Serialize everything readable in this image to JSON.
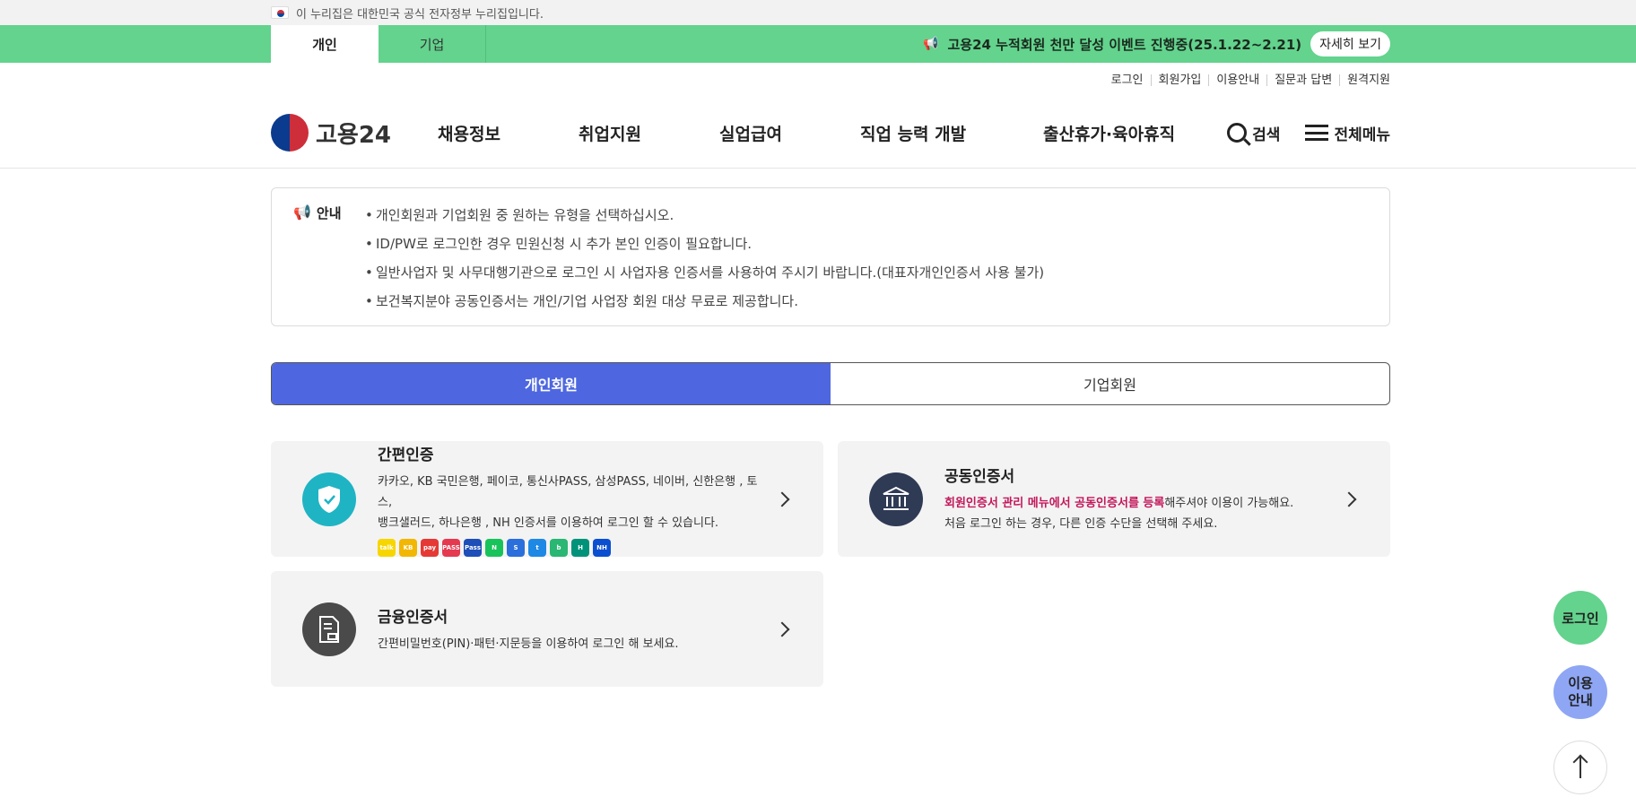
{
  "gov_banner": {
    "text": "이 누리집은 대한민국 공식 전자정부 누리집입니다."
  },
  "top_tabs": [
    {
      "label": "개인"
    },
    {
      "label": "기업"
    }
  ],
  "event": {
    "text": "고용24 누적회원 천만 달성 이벤트 진행중(25.1.22~2.21)",
    "button": "자세히 보기"
  },
  "util_links": [
    "로그인",
    "회원가입",
    "이용안내",
    "질문과 답변",
    "원격지원"
  ],
  "header": {
    "logo": "고용24",
    "menu": [
      "채용정보",
      "취업지원",
      "실업급여",
      "직업 능력 개발",
      "출산휴가·육아휴직"
    ],
    "search": "검색",
    "all_menu": "전체메뉴"
  },
  "notice": {
    "label": "안내",
    "items": [
      "개인회원과 기업회원 중 원하는 유형을 선택하십시오.",
      "ID/PW로 로그인한 경우 민원신청 시 추가 본인 인증이 필요합니다.",
      "일반사업자 및 사무대행기관으로 로그인 시 사업자용 인증서를 사용하여 주시기 바랍니다.(대표자개인인증서 사용 불가)",
      "보건복지분야 공동인증서는 개인/기업 사업장 회원 대상 무료로 제공합니다."
    ]
  },
  "member_tabs": [
    {
      "label": "개인회원",
      "active": true
    },
    {
      "label": "기업회원",
      "active": false
    }
  ],
  "cards": {
    "simple": {
      "title": "간편인증",
      "desc1": "카카오, KB 국민은행, 페이코, 통신사PASS, 삼성PASS, 네이버, 신한은행 , 토스,",
      "desc2": "뱅크샐러드, 하나은행 , NH 인증서를 이용하여 로그인 할 수 있습니다.",
      "banks": [
        {
          "label": "talk",
          "color": "#f7d600"
        },
        {
          "label": "KB",
          "color": "#f2b705"
        },
        {
          "label": "pay",
          "color": "#e53935"
        },
        {
          "label": "PASS",
          "color": "#e53950"
        },
        {
          "label": "Pass",
          "color": "#1e4fb8"
        },
        {
          "label": "N",
          "color": "#19c35b"
        },
        {
          "label": "S",
          "color": "#2a6fdb"
        },
        {
          "label": "t",
          "color": "#1e88e5"
        },
        {
          "label": "b",
          "color": "#2ab673"
        },
        {
          "label": "H",
          "color": "#00937a"
        },
        {
          "label": "NH",
          "color": "#0b4fd1"
        }
      ]
    },
    "joint": {
      "title": "공동인증서",
      "desc_hl": "회원인증서 관리 메뉴에서 공동인증서를 등록",
      "desc_rest": "해주셔야 이용이 가능해요.",
      "desc2": "처음 로그인 하는 경우, 다른 인증 수단을 선택해 주세요."
    },
    "finance": {
      "title": "금융인증서",
      "desc": "간편비밀번호(PIN)·패턴·지문등을 이용하여 로그인 해 보세요."
    }
  },
  "floating": {
    "login": "로그인",
    "guide_line1": "이용",
    "guide_line2": "안내"
  },
  "colors": {
    "green": "#63d38d",
    "blue": "#4e67e0",
    "teal": "#1fb4c4",
    "navy": "#2f3a55"
  }
}
